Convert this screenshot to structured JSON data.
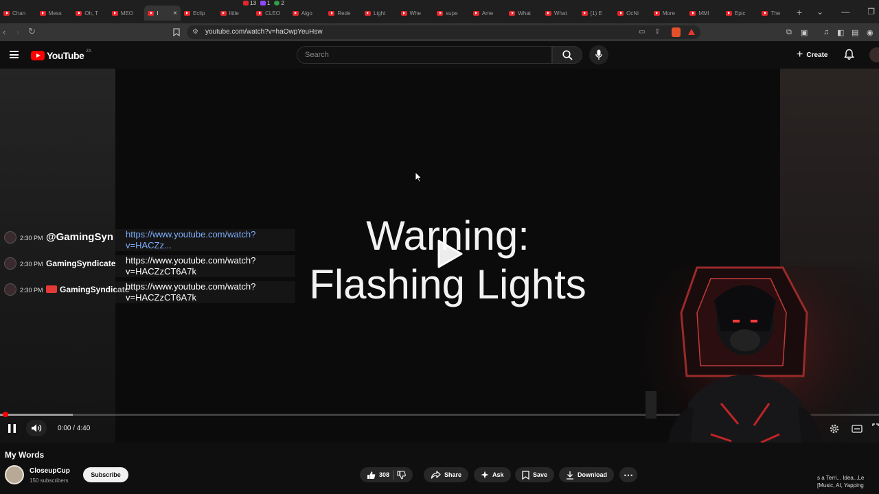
{
  "browser": {
    "badges": [
      {
        "count": "13",
        "color": "#e3252c"
      },
      {
        "count": "1",
        "color": "#9146ff"
      },
      {
        "count": "2",
        "color": "#2ea043"
      }
    ],
    "tabs": [
      {
        "label": "Chan"
      },
      {
        "label": "Mess"
      },
      {
        "label": "Oh, T"
      },
      {
        "label": "MEO"
      },
      {
        "label": "I",
        "active": true
      },
      {
        "label": "Eclip"
      },
      {
        "label": "little"
      },
      {
        "label": "CLEO"
      },
      {
        "label": "Algo"
      },
      {
        "label": "Rede"
      },
      {
        "label": "Light"
      },
      {
        "label": "Whe"
      },
      {
        "label": "supe"
      },
      {
        "label": "Ame"
      },
      {
        "label": "What"
      },
      {
        "label": "What"
      },
      {
        "label": "(1) E"
      },
      {
        "label": "OcNi"
      },
      {
        "label": "More"
      },
      {
        "label": "MMI"
      },
      {
        "label": "Epic"
      },
      {
        "label": "The"
      }
    ],
    "url": "youtube.com/watch?v=haOwpYeuHsw"
  },
  "youtube": {
    "logo_text": "YouTube",
    "country_code": "ZA",
    "search_placeholder": "Search",
    "create_label": "Create"
  },
  "video": {
    "title_line1": "Warning:",
    "title_line2": "Flashing Lights",
    "current_time": "0:00",
    "duration": "4:40",
    "time_display": "0:00 / 4:40",
    "played_fraction": 0.0,
    "buffered_fraction": 0.083
  },
  "chat_overlay": [
    {
      "time": "2:30 PM",
      "name": "@GamingSyn",
      "msg_line1": "https://www.youtube.com/watch?",
      "msg_line2": "v=HACZz...",
      "link": true
    },
    {
      "time": "2:30 PM",
      "name": "GamingSyndicate",
      "msg_line1": "https://www.youtube.com/watch?",
      "msg_line2": "v=HACZzCT6A7k",
      "link": false
    },
    {
      "time": "2:30 PM",
      "name": "GamingSyndicate",
      "msg_line1": "https://www.youtube.com/watch?",
      "msg_line2": "v=HACZzCT6A7k",
      "link": false,
      "camera": true
    }
  ],
  "below": {
    "video_title": "My Words",
    "channel_name": "CloseupCup",
    "subscribers": "150 subscribers",
    "subscribe_label": "Subscribe",
    "likes": "308",
    "share_label": "Share",
    "ask_label": "Ask",
    "save_label": "Save",
    "download_label": "Download",
    "ticker_line1": "s a Terri... Idea...Le",
    "ticker_line2": "[Music, AI, Yapping"
  },
  "colors": {
    "accent_red": "#ff0000",
    "link_blue": "#7fb0ff",
    "chrome_bg": "#1f1f1f"
  }
}
